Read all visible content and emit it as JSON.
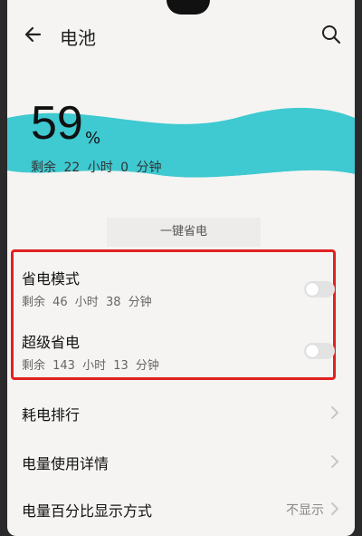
{
  "header": {
    "title": "电池"
  },
  "battery": {
    "percent": "59",
    "percent_sign": "%",
    "remaining": "剩余 22 小时 0 分钟"
  },
  "one_key": {
    "label": "一键省电"
  },
  "power_saving": {
    "title": "省电模式",
    "remaining": "剩余 46 小时 38 分钟",
    "enabled": false
  },
  "ultra_saving": {
    "title": "超级省电",
    "remaining": "剩余 143 小时 13 分钟",
    "enabled": false
  },
  "list": [
    {
      "label": "耗电排行"
    },
    {
      "label": "电量使用详情"
    },
    {
      "label": "电量百分比显示方式",
      "value": "不显示"
    }
  ],
  "colors": {
    "wave": "#3fc9d1",
    "highlight_box": "#e12121",
    "background": "#f5f4f2"
  }
}
